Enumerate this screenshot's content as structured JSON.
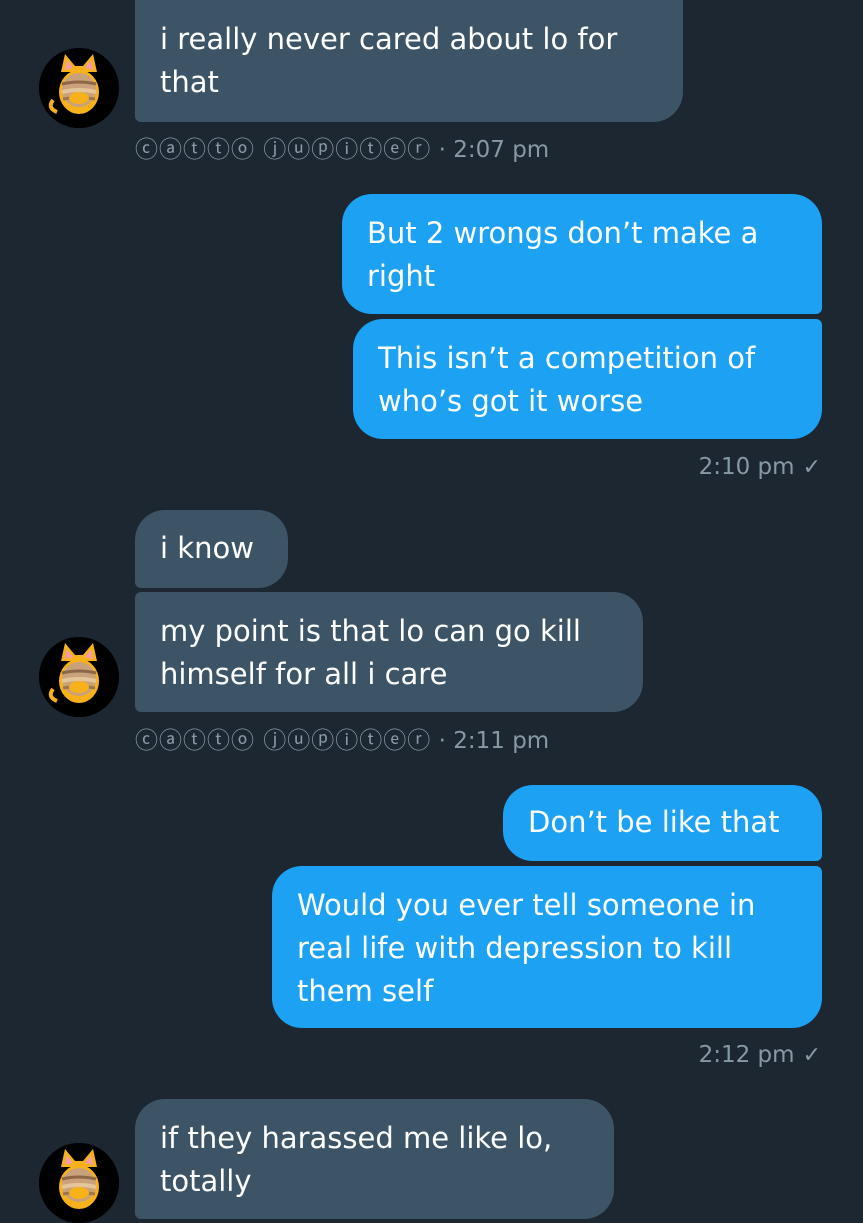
{
  "conversation": {
    "sender_name": "ⓒⓐⓣⓣⓞ ⓙⓤⓟⓘⓣⓔⓡ",
    "messages": [
      {
        "id": "m1",
        "direction": "incoming",
        "text": "i really never cared about lo for that"
      },
      {
        "id": "m2",
        "direction": "outgoing",
        "text": "But 2 wrongs don’t make a right"
      },
      {
        "id": "m3",
        "direction": "outgoing",
        "text": "This isn’t a competition of who’s got it worse"
      },
      {
        "id": "m4",
        "direction": "incoming",
        "text": "i know"
      },
      {
        "id": "m5",
        "direction": "incoming",
        "text": "my point is that lo can go kill himself for all i care"
      },
      {
        "id": "m6",
        "direction": "outgoing",
        "text": "Don’t be like that"
      },
      {
        "id": "m7",
        "direction": "outgoing",
        "text": "Would you ever tell someone in real life with depression to kill them self"
      },
      {
        "id": "m8",
        "direction": "incoming",
        "text": "if they harassed me like lo, totally"
      }
    ],
    "meta": {
      "group1_time": "· 2:07 pm",
      "group2_time": "2:10 pm",
      "group3_time": "· 2:11 pm",
      "group4_time": "2:12 pm",
      "read_check": "✓"
    },
    "colors": {
      "background": "#1c2732",
      "incoming_bubble": "#3d5466",
      "outgoing_bubble": "#1da1f2",
      "meta_text": "#8899a6"
    }
  }
}
